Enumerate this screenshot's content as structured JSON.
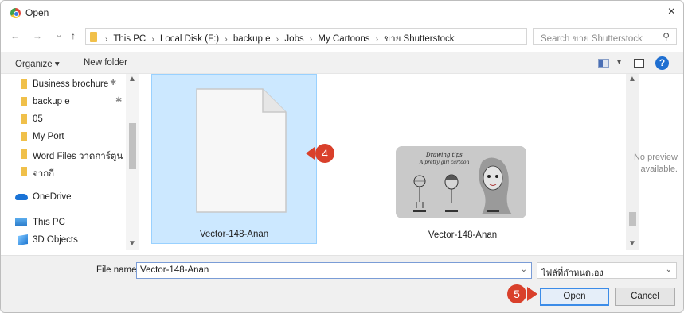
{
  "window": {
    "title": "Open",
    "close_glyph": "×"
  },
  "nav": {
    "back_glyph": "←",
    "forward_glyph": "→",
    "recent_glyph": "⌄",
    "up_glyph": "↑",
    "breadcrumbs": [
      "This PC",
      "Local Disk (F:)",
      "backup e",
      "Jobs",
      "My Cartoons",
      "ขาย Shutterstock"
    ],
    "search_placeholder": "Search ขาย Shutterstock"
  },
  "toolbar": {
    "organize_label": "Organize ▾",
    "new_folder_label": "New folder",
    "help_glyph": "?"
  },
  "sidebar": {
    "items": [
      {
        "label": "Business brochure",
        "icon": "folder-icon",
        "pinned": true
      },
      {
        "label": "backup e",
        "icon": "folder-icon",
        "pinned": true
      },
      {
        "label": "05",
        "icon": "folder-icon",
        "pinned": false
      },
      {
        "label": "My Port",
        "icon": "folder-icon",
        "pinned": false
      },
      {
        "label": "Word Files วาดการ์ตูน",
        "icon": "folder-icon",
        "pinned": false
      },
      {
        "label": "จากกี",
        "icon": "folder-icon",
        "pinned": false
      },
      {
        "label": "OneDrive",
        "icon": "cloud-icon",
        "pinned": false
      },
      {
        "label": "This PC",
        "icon": "computer-icon",
        "pinned": false
      },
      {
        "label": "3D Objects",
        "icon": "3d-objects-icon",
        "pinned": false
      }
    ]
  },
  "files": [
    {
      "name": "Vector-148-Anan",
      "selected": true,
      "type": "document"
    },
    {
      "name": "Vector-148-Anan",
      "selected": false,
      "type": "image-preview",
      "thumbnail_text": "Drawing tips A pretty girl cartoon"
    }
  ],
  "preview_pane": {
    "line1": "No preview",
    "line2": "available."
  },
  "bottom": {
    "file_name_label": "File name:",
    "file_name_value": "Vector-148-Anan",
    "file_type_value": "ไฟล์ที่กำหนดเอง",
    "open_label": "Open",
    "cancel_label": "Cancel"
  },
  "callouts": {
    "step4": "4",
    "step5": "5"
  },
  "colors": {
    "callout": "#d9402b",
    "selection": "#cce8ff",
    "accent": "#3c8ce8"
  }
}
